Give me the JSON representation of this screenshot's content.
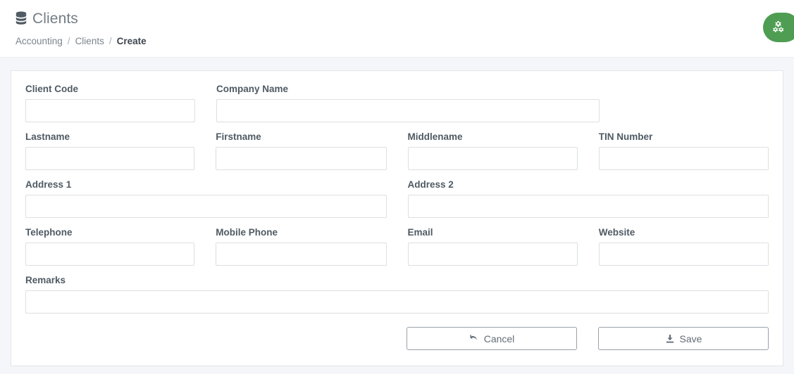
{
  "header": {
    "icon": "database-icon",
    "title": "Clients",
    "breadcrumb": [
      {
        "label": "Accounting",
        "active": false
      },
      {
        "label": "Clients",
        "active": false
      },
      {
        "label": "Create",
        "active": true
      }
    ],
    "separator": "/",
    "settings_button": {
      "icon": "gears-icon",
      "color": "#4e9d52"
    }
  },
  "form": {
    "fields": {
      "client_code": {
        "label": "Client Code",
        "value": "",
        "placeholder": ""
      },
      "company_name": {
        "label": "Company Name",
        "value": "",
        "placeholder": ""
      },
      "lastname": {
        "label": "Lastname",
        "value": "",
        "placeholder": ""
      },
      "firstname": {
        "label": "Firstname",
        "value": "",
        "placeholder": ""
      },
      "middlename": {
        "label": "Middlename",
        "value": "",
        "placeholder": ""
      },
      "tin_number": {
        "label": "TIN Number",
        "value": "",
        "placeholder": ""
      },
      "address1": {
        "label": "Address 1",
        "value": "",
        "placeholder": ""
      },
      "address2": {
        "label": "Address 2",
        "value": "",
        "placeholder": ""
      },
      "telephone": {
        "label": "Telephone",
        "value": "",
        "placeholder": ""
      },
      "mobile_phone": {
        "label": "Mobile Phone",
        "value": "",
        "placeholder": ""
      },
      "email": {
        "label": "Email",
        "value": "",
        "placeholder": ""
      },
      "website": {
        "label": "Website",
        "value": "",
        "placeholder": ""
      },
      "remarks": {
        "label": "Remarks",
        "value": "",
        "placeholder": ""
      }
    },
    "actions": {
      "cancel": {
        "label": "Cancel",
        "icon": "reply-arrow-icon"
      },
      "save": {
        "label": "Save",
        "icon": "download-icon"
      }
    }
  }
}
